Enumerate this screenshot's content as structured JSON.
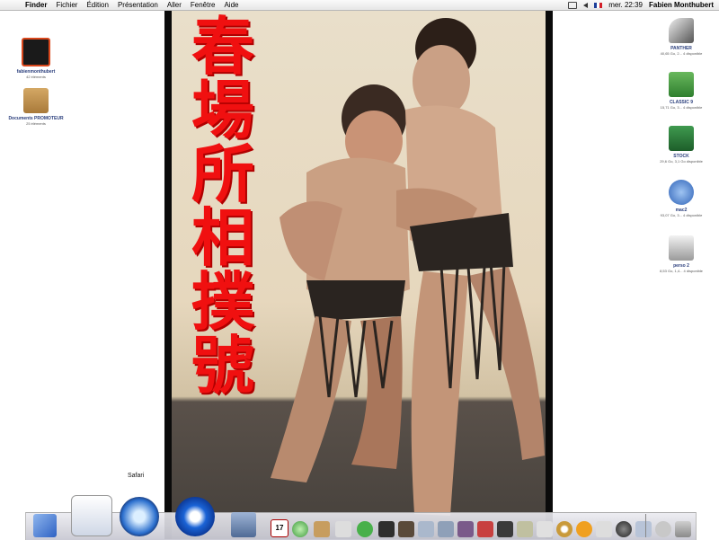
{
  "menubar": {
    "items": [
      {
        "label": "Finder",
        "bold": true
      },
      {
        "label": "Fichier"
      },
      {
        "label": "Édition"
      },
      {
        "label": "Présentation"
      },
      {
        "label": "Aller"
      },
      {
        "label": "Fenêtre"
      },
      {
        "label": "Aide"
      }
    ],
    "clock": "mer. 22:39",
    "user": "Fabien Monthubert"
  },
  "poster": {
    "kanji": [
      "春",
      "場",
      "所",
      "相",
      "撲",
      "號"
    ]
  },
  "desktop_left": [
    {
      "label": "fabienmonthubert",
      "sub": "42 éléments",
      "icon": "person-folder-icon",
      "color": "#d9471c"
    },
    {
      "label": "Documents PROMOTEUR",
      "sub": "25 éléments",
      "icon": "package-box-icon",
      "color": "#b8843e"
    }
  ],
  "desktop_right": [
    {
      "label": "PANTHER",
      "sub": "40,65 Go, 2... 4 disponible",
      "icon": "flashlight-disk-icon",
      "color": "#333333"
    },
    {
      "label": "CLASSIC 9",
      "sub": "15,71 Go, 3... 4 disponible",
      "icon": "os9-disk-icon",
      "color": "#3f8f3f"
    },
    {
      "label": "STOCK",
      "sub": "29,6 Go, 3,1 Go disponible",
      "icon": "green-drive-icon",
      "color": "#2d7a3c"
    },
    {
      "label": "mac2",
      "sub": "93,07 Go, 3... 4 disponible",
      "icon": "network-disk-icon",
      "color": "#3b6fc2"
    },
    {
      "label": "perso 2",
      "sub": "8,53 Go, 1,4... 4 disponible",
      "icon": "hard-drive-icon",
      "color": "#b0b0b0"
    }
  ],
  "dock": {
    "tooltip": "Safari",
    "calendar_day": "17"
  }
}
